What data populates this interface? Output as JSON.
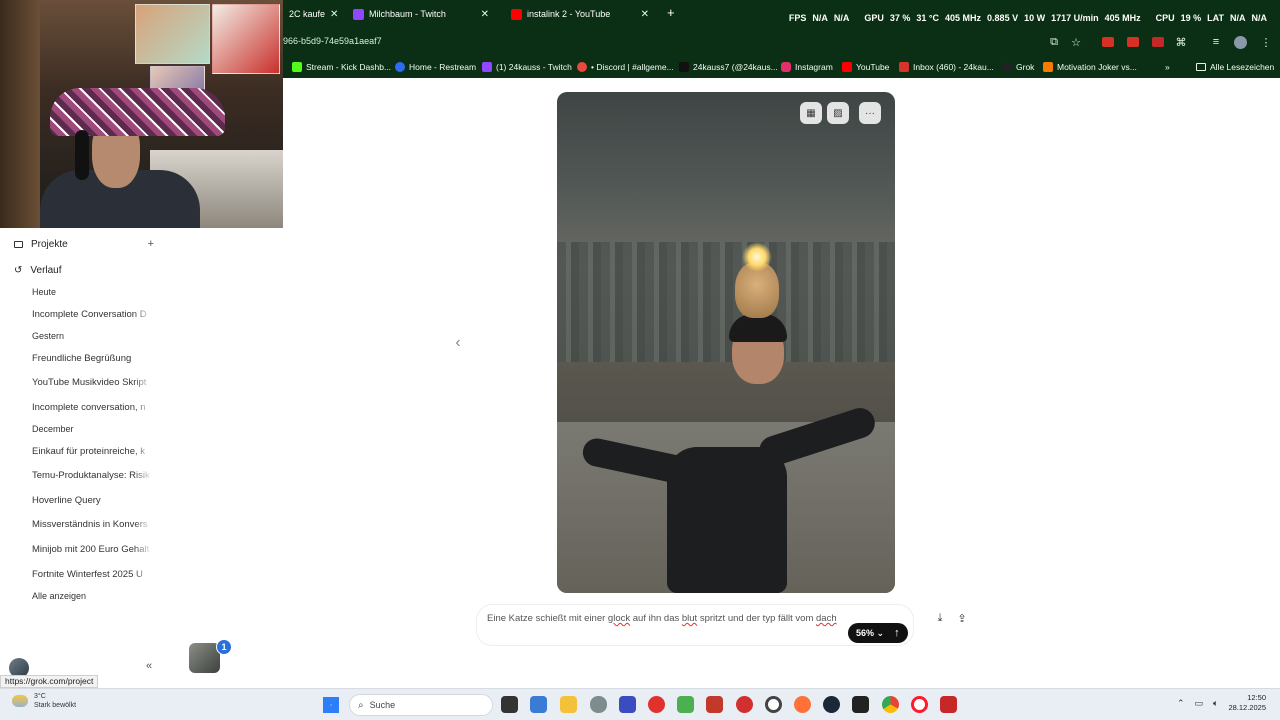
{
  "browser": {
    "tabs": [
      {
        "label": "2C kaufe",
        "active": false
      },
      {
        "label": "Milchbaum - Twitch",
        "active": false
      },
      {
        "label": "instalink 2 - YouTube",
        "active": false
      }
    ],
    "url": "966-b5d9-74e59a1aeaf7",
    "hw_stats": [
      "FPS",
      "N/A",
      "N/A",
      "GPU",
      "37 %",
      "31 °C",
      "405 MHz",
      "0.885 V",
      "10 W",
      "1717 U/min",
      "405 MHz",
      "CPU",
      "19 %",
      "LAT",
      "N/A",
      "N/A"
    ],
    "bookmarks": [
      {
        "label": "Stream - Kick Dashb...",
        "color": "#53fc18"
      },
      {
        "label": "Home - Restream",
        "color": "#2d6cf5"
      },
      {
        "label": "(1) 24kauss - Twitch",
        "color": "#9146ff"
      },
      {
        "label": "• Discord | #allgeme...",
        "color": "#e84a3f"
      },
      {
        "label": "24kauss7 (@24kaus...",
        "color": "#111111"
      },
      {
        "label": "Instagram",
        "color": "#e1306c"
      },
      {
        "label": "YouTube",
        "color": "#ff0000"
      },
      {
        "label": "Inbox (460) - 24kau...",
        "color": "#d9342b"
      },
      {
        "label": "Grok",
        "color": "#222222"
      },
      {
        "label": "Motivation Joker vs...",
        "color": "#f57c00"
      }
    ],
    "bookmarks_more": "»",
    "all_bookmarks": "Alle Lesezeichen"
  },
  "sidebar": {
    "projects": "Projekte",
    "history": "Verlauf",
    "sections": [
      {
        "title": "Heute",
        "items": [
          "Incomplete Conversation D"
        ]
      },
      {
        "title": "Gestern",
        "items": [
          "Freundliche Begrüßung",
          "YouTube Musikvideo Skript",
          "Incomplete conversation, n"
        ]
      },
      {
        "title": "December",
        "items": [
          "Einkauf für proteinreiche, k",
          "Temu-Produktanalyse: Risik",
          "Hoverline Query",
          "Missverständnis in Konvers",
          "Minijob mit 200 Euro Gehalt",
          "Fortnite Winterfest 2025 U"
        ]
      }
    ],
    "show_all": "Alle anzeigen",
    "status_url": "https://grok.com/project"
  },
  "main": {
    "prompt_parts": [
      "Eine Katze schießt mit einer ",
      "glock",
      " auf ihn das ",
      "blut",
      " spritzt und der typ fällt vom ",
      "dach"
    ],
    "zoom_label": "56%",
    "mini_badge": "1"
  },
  "taskbar": {
    "weather_temp": "3°C",
    "weather_desc": "Stark bewölkt",
    "search_placeholder": "Suche",
    "time": "12:50",
    "date": "28.12.2025",
    "apps": [
      {
        "name": "file-explorer",
        "color": "#333333"
      },
      {
        "name": "calculator",
        "color": "#3a7bd5"
      },
      {
        "name": "folder",
        "color": "#f3c13a"
      },
      {
        "name": "mouse-app",
        "color": "#7f8c8d"
      },
      {
        "name": "v-app",
        "color": "#3b4cc0"
      },
      {
        "name": "opera-gx",
        "color": "#e2312d"
      },
      {
        "name": "layers-app",
        "color": "#4caf50"
      },
      {
        "name": "gray-box-app",
        "color": "#c0392b"
      },
      {
        "name": "red-circle-app",
        "color": "#d32f2f"
      },
      {
        "name": "ring-app",
        "color": "#444444"
      },
      {
        "name": "firefox",
        "color": "#ff7139"
      },
      {
        "name": "steam",
        "color": "#1b2838"
      },
      {
        "name": "epic-games",
        "color": "#222222"
      },
      {
        "name": "chrome",
        "color": "#34a853"
      },
      {
        "name": "opera",
        "color": "#ff1b2d"
      },
      {
        "name": "red-box-app",
        "color": "#c62828"
      }
    ]
  }
}
